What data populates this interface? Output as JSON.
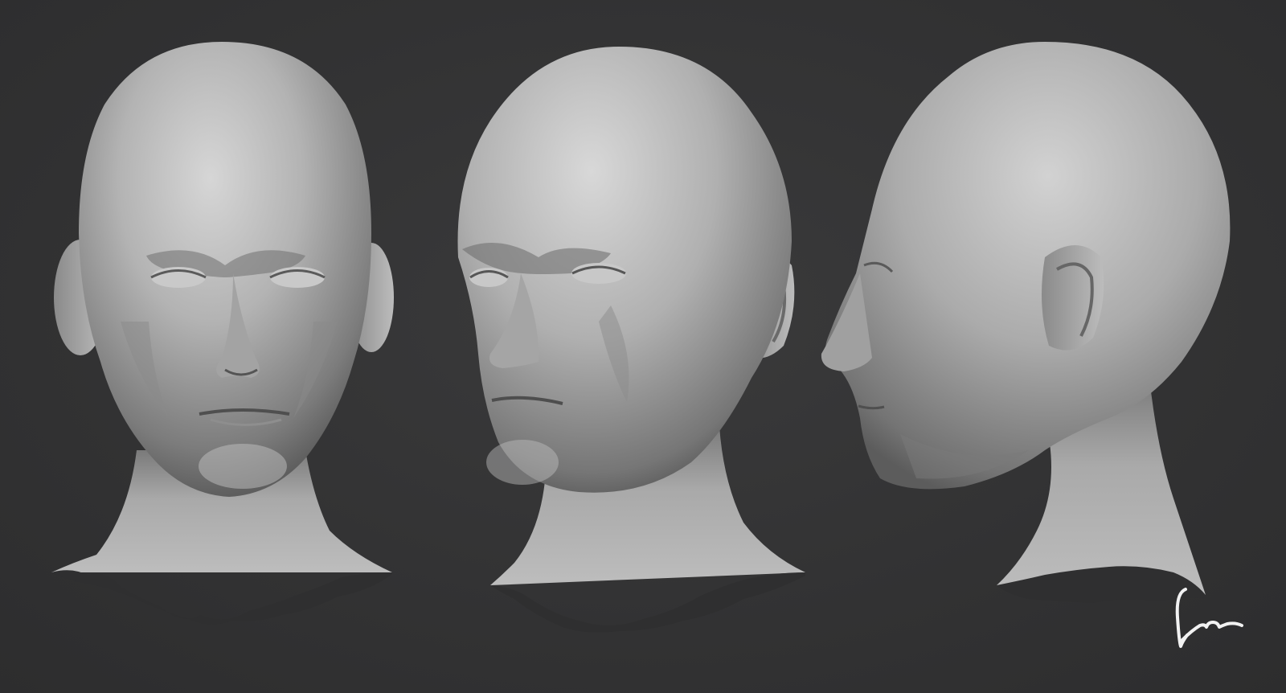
{
  "scene": {
    "background_color": "#333334",
    "sculpt_color": "#b9b9b9",
    "views": [
      {
        "name": "front-view"
      },
      {
        "name": "three-quarter-view"
      },
      {
        "name": "profile-view"
      }
    ]
  },
  "signature": {
    "kind": "handwritten-signature",
    "color": "#f2f2f2"
  }
}
